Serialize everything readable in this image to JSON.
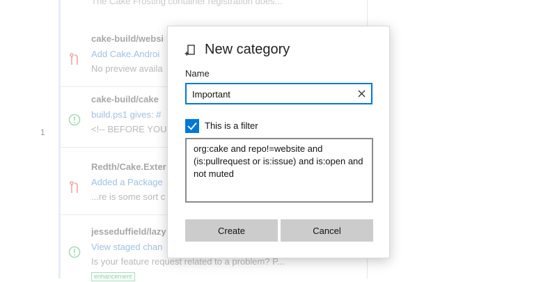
{
  "background": {
    "line_number": "1",
    "top_text": "The Cake Frosting container registration does...",
    "items": [
      {
        "repo": "cake-build/websi",
        "title": "Add Cake.Androi",
        "body": "No preview availa",
        "icon": "pull-request-icon",
        "badge": ""
      },
      {
        "repo": "cake-build/cake",
        "title": "build.ps1 gives: #",
        "body": "<!-- BEFORE YOU",
        "icon": "issue-icon",
        "badge": ""
      },
      {
        "repo": "Redth/Cake.Exter",
        "title": "Added a Package",
        "body": "...re is some sort c",
        "icon": "pull-request-icon",
        "badge": ""
      },
      {
        "repo": "jesseduffield/lazy",
        "title": "View staged chan",
        "body": "Is your feature request related to a problem? P...",
        "icon": "issue-icon",
        "badge": "enhancement"
      }
    ],
    "colors": {
      "pr_icon": "#f4a3a3",
      "issue_icon": "#a5dcb7"
    }
  },
  "dialog": {
    "title": "New category",
    "title_icon": "new-category-icon",
    "name_label": "Name",
    "name_value": "Important",
    "clear_icon": "close-icon",
    "filter_checkbox_checked": true,
    "filter_checkbox_label": "This is a filter",
    "filter_text": "org:cake and repo!=website and (is:pullrequest or is:issue) and is:open and not muted",
    "create_label": "Create",
    "cancel_label": "Cancel",
    "colors": {
      "accent": "#0078d7",
      "button_bg": "#cccccc"
    }
  }
}
